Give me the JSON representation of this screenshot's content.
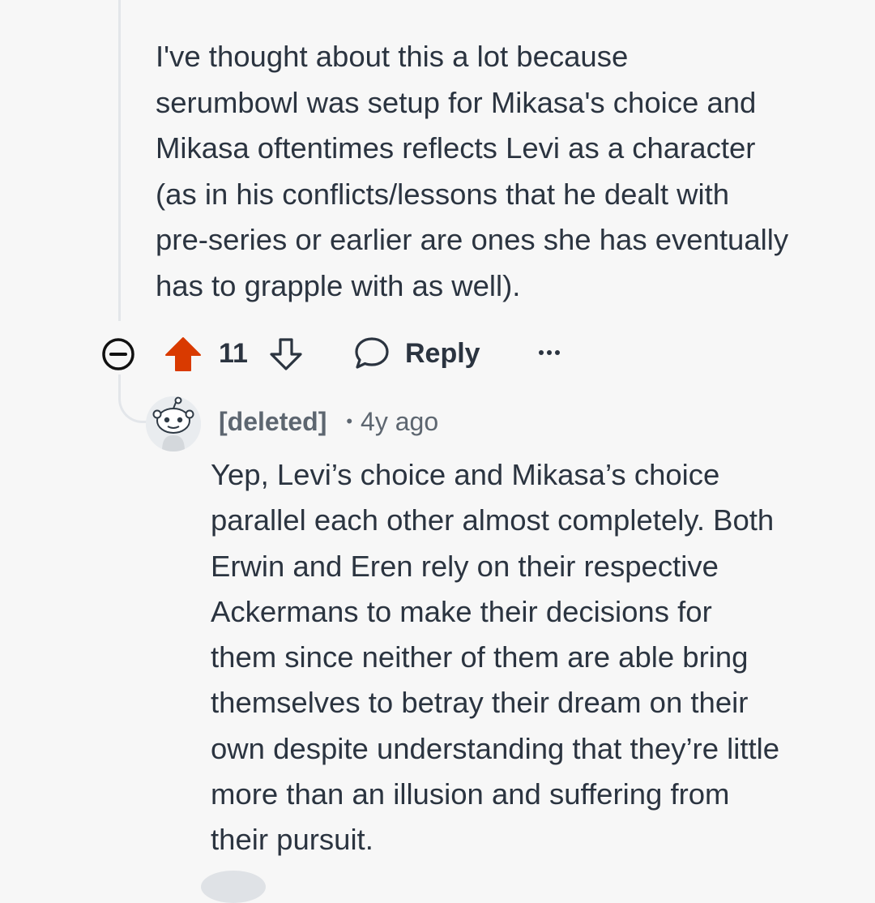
{
  "parent_comment": {
    "lines": [
      "I've thought about this a lot because",
      "serumbowl was setup for Mikasa's choice and",
      "Mikasa oftentimes reflects Levi as a character",
      "(as in his conflicts/lessons that he dealt with",
      "pre-series or earlier are ones she has eventually",
      "has to grapple with as well)."
    ]
  },
  "actions": {
    "collapse_icon": "minus-circle-icon",
    "upvote_icon": "upvote-arrow-icon",
    "upvote_color": "#d93a00",
    "vote_count": "11",
    "downvote_icon": "downvote-arrow-icon",
    "reply_icon": "speech-bubble-icon",
    "reply_label": "Reply",
    "more_icon": "ellipsis-icon"
  },
  "reply_comment": {
    "avatar_icon": "snoo-avatar-icon",
    "username": "[deleted]",
    "separator": "•",
    "timestamp": "4y ago",
    "lines": [
      "Yep, Levi’s choice and Mikasa’s choice",
      "parallel each other almost completely. Both",
      "Erwin and Eren rely on their respective",
      "Ackermans to make their decisions for",
      "them since neither of them are able bring",
      "themselves to betray their dream on their",
      "own despite understanding that they’re little",
      "more than an illusion and suffering from",
      "their pursuit."
    ]
  }
}
